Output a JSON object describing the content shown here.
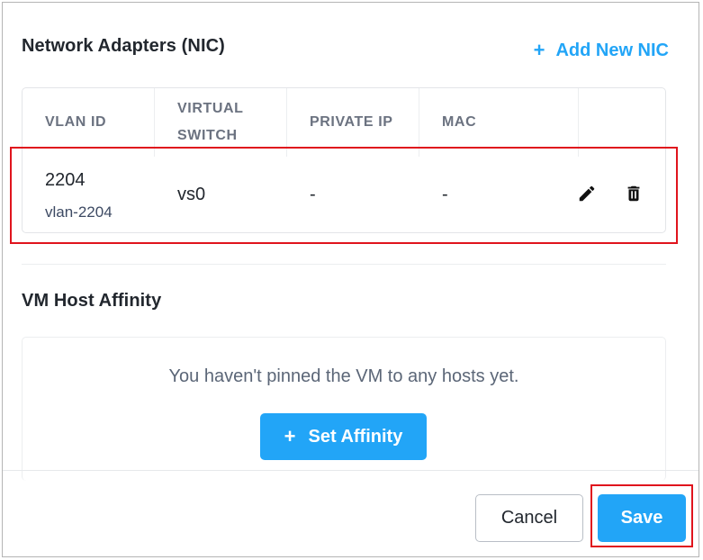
{
  "nic_section": {
    "title": "Network Adapters (NIC)",
    "add_button_label": "Add New NIC",
    "add_icon": "+",
    "columns": [
      "VLAN ID",
      "VIRTUAL SWITCH",
      "PRIVATE IP",
      "MAC"
    ],
    "rows": [
      {
        "vlan_id": "2204",
        "vlan_name": "vlan-2204",
        "virtual_switch": "vs0",
        "private_ip": "-",
        "mac": "-",
        "actions": [
          "pencil-icon",
          "trash-icon"
        ]
      }
    ]
  },
  "affinity_section": {
    "title": "VM Host Affinity",
    "empty_message": "You haven't pinned the VM to any hosts yet.",
    "set_affinity_label": "Set Affinity",
    "set_affinity_icon": "+"
  },
  "footer": {
    "cancel_label": "Cancel",
    "save_label": "Save"
  },
  "colors": {
    "accent": "#22a5f7",
    "highlight": "#e0141d",
    "text": "#22272e",
    "header_text": "#6b7280"
  }
}
